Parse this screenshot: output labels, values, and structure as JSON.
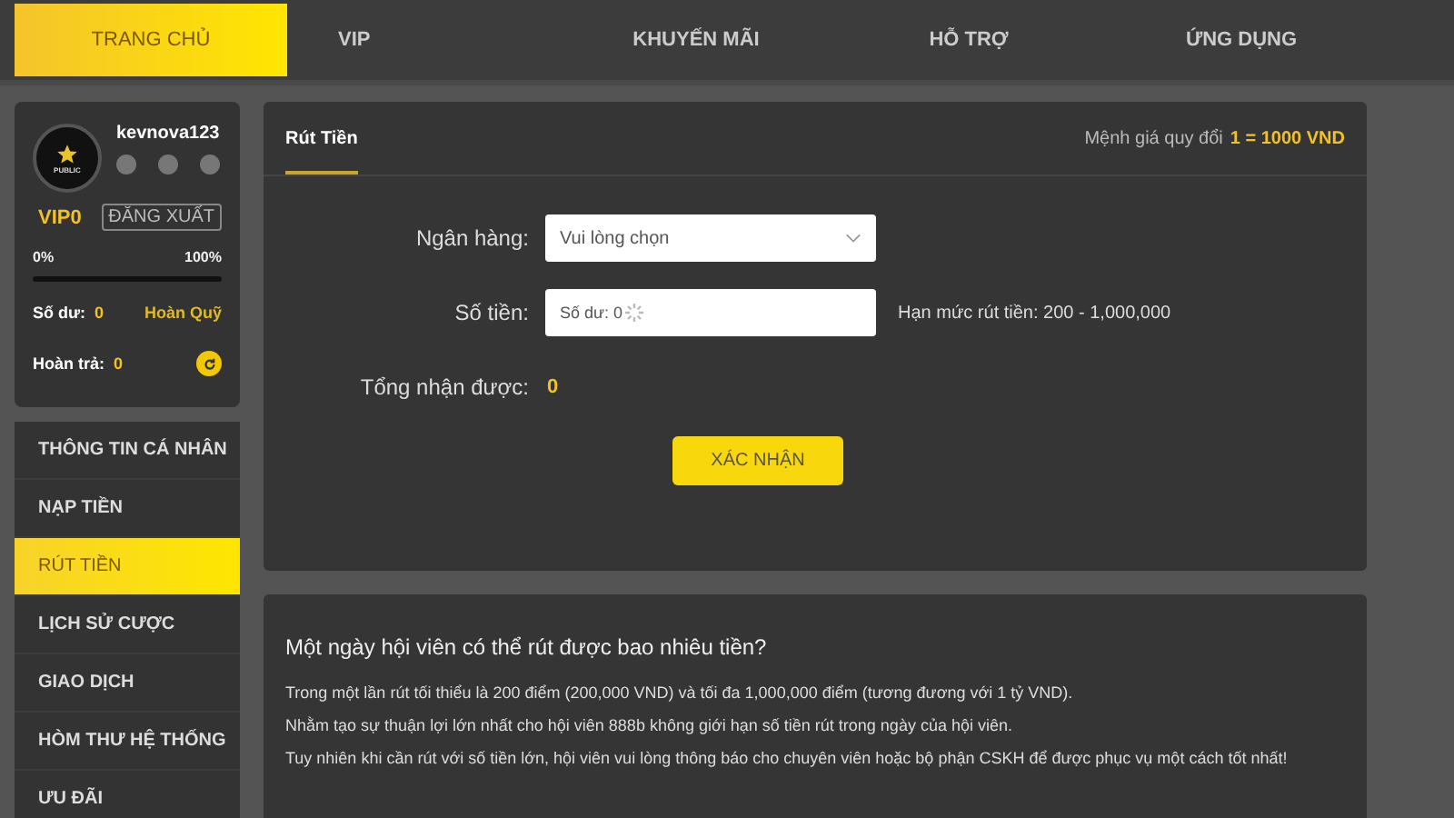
{
  "nav": [
    {
      "label": "TRANG CHỦ",
      "selected": true
    },
    {
      "label": "VIP",
      "selected": false
    },
    {
      "label": "KHUYẾN MÃI",
      "selected": false
    },
    {
      "label": "HỖ TRỢ",
      "selected": false
    },
    {
      "label": "ỨNG DỤNG",
      "selected": false
    }
  ],
  "profile": {
    "avatar_label": "PUBLIC",
    "username": "kevnova123",
    "vip": "VIP0",
    "logout": "ĐĂNG XUẤT",
    "progress_start": "0%",
    "progress_end": "100%",
    "level": 0,
    "balance_label": "Số dư:",
    "balance": "0",
    "refund_link": "Hoàn Quỹ",
    "rebate_label": "Hoàn trả:",
    "rebate": "0"
  },
  "menu": [
    {
      "label": "THÔNG TIN CÁ NHÂN",
      "selected": false
    },
    {
      "label": "NẠP TIỀN",
      "selected": false
    },
    {
      "label": "RÚT TIỀN",
      "selected": true
    },
    {
      "label": "LỊCH SỬ CƯỢC",
      "selected": false
    },
    {
      "label": "GIAO DỊCH",
      "selected": false
    },
    {
      "label": "HÒM THƯ HỆ THỐNG",
      "selected": false
    },
    {
      "label": "ƯU ĐÃI",
      "selected": false
    }
  ],
  "withdraw": {
    "tab": "Rút Tiền",
    "rate_label": "Mệnh giá quy đổi",
    "rate_value": "1 = 1000 VND",
    "bank_label": "Ngân hàng:",
    "bank_value": "Vui lòng chọn",
    "amount_label": "Số tiền:",
    "amount_placeholder": "Số dư: 0",
    "limit": "Hạn mức rút tiền: 200 - 1,000,000",
    "total_label": "Tổng nhận được:",
    "total_value": "0",
    "submit": "XÁC NHẬN"
  },
  "info": {
    "heading": "Một ngày hội viên có thể rút được bao nhiêu tiền?",
    "paragraphs": [
      "Trong một lần rút tối thiểu là 200 điểm (200,000 VND) và tối đa 1,000,000 điểm (tương đương với 1 tỷ VND).",
      "Nhằm tạo sự thuận lợi lớn nhất cho hội viên 888b không giới hạn số tiền rút trong ngày của hội viên.",
      "Tuy nhiên khi cần rút với số tiền lớn, hội viên vui lòng thông báo cho chuyên viên hoặc bộ phận CSKH để được phục vụ một cách tốt nhất!"
    ]
  }
}
